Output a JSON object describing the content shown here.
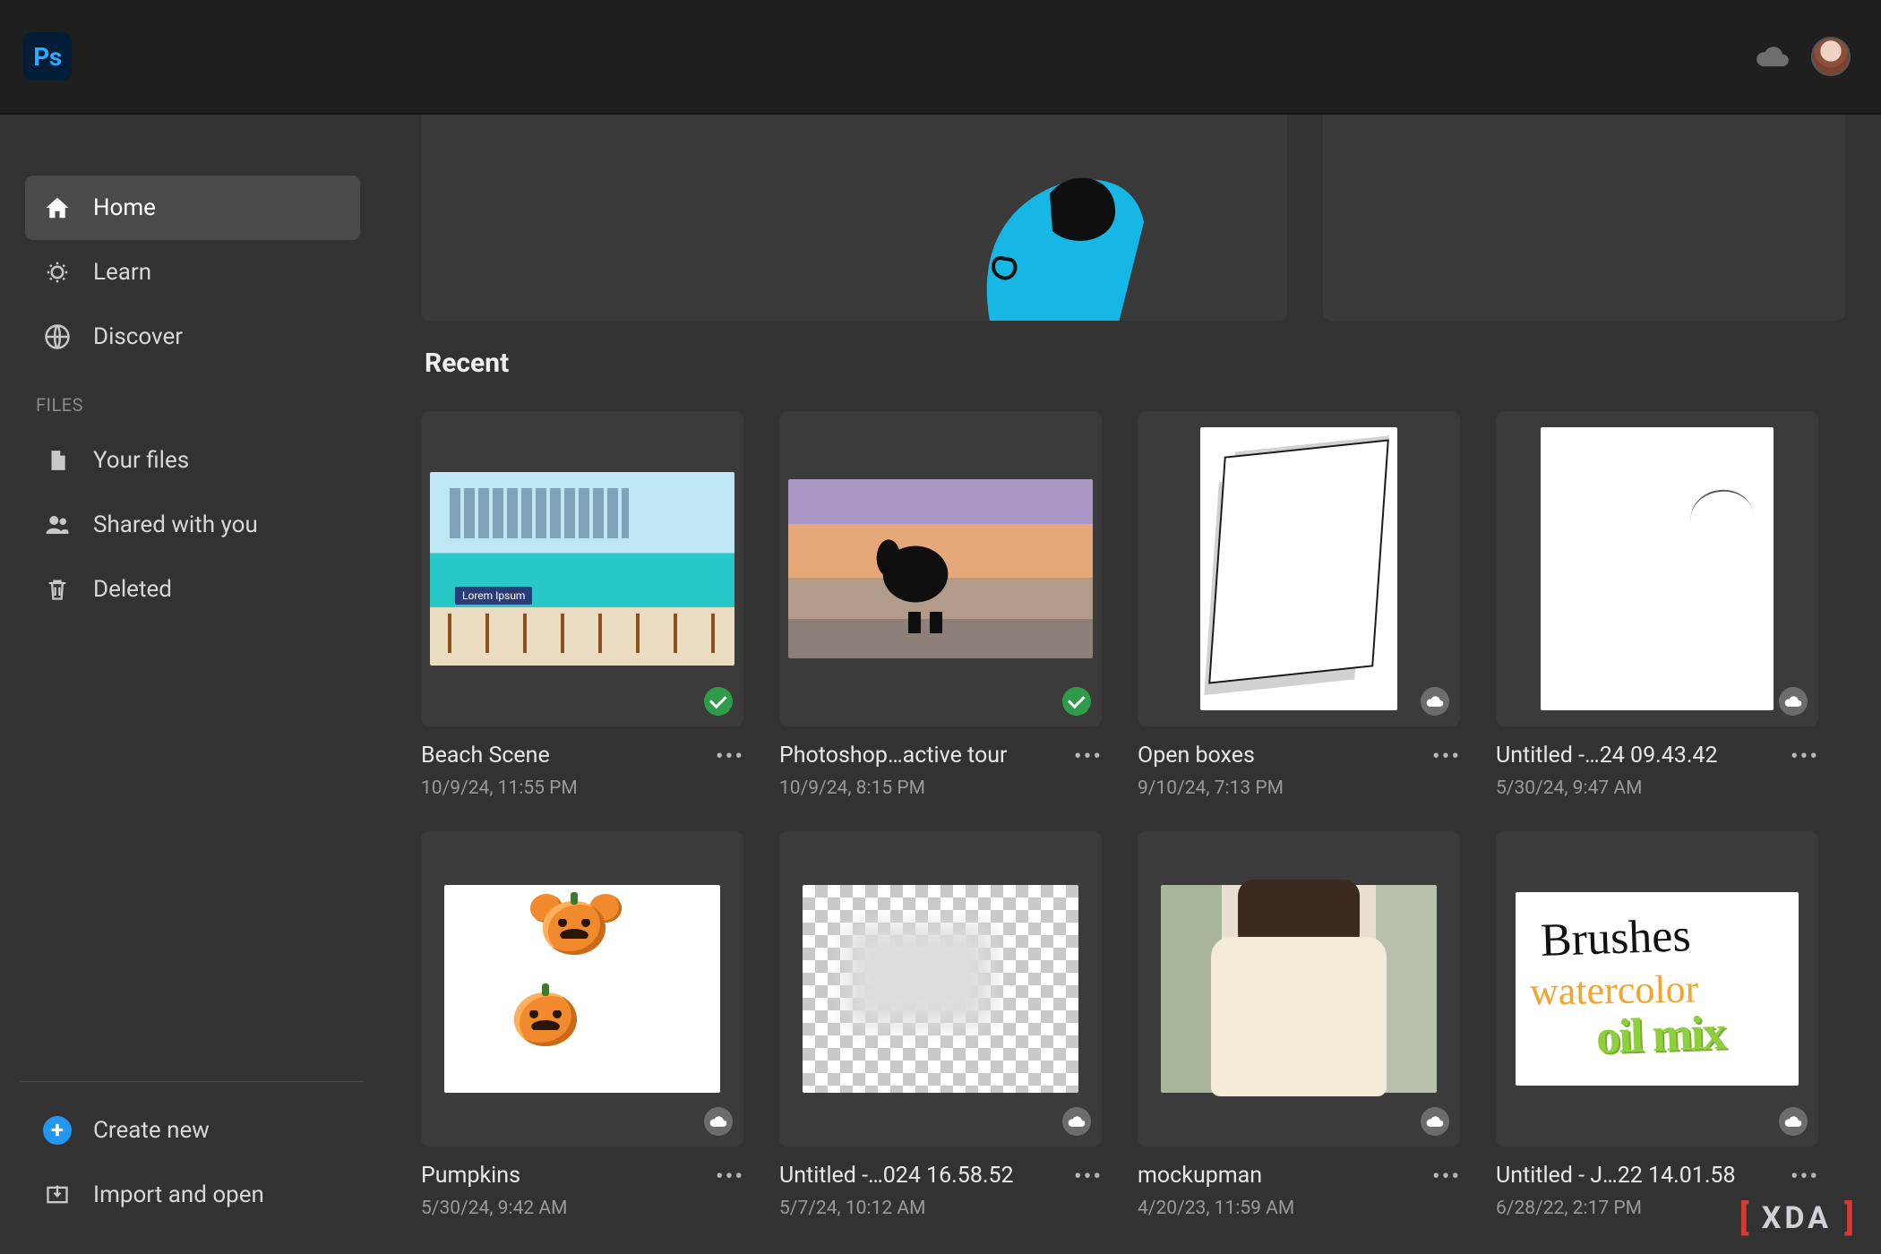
{
  "app": {
    "logo_text": "Ps"
  },
  "sidebar": {
    "items": [
      {
        "label": "Home",
        "icon": "home-icon",
        "active": true
      },
      {
        "label": "Learn",
        "icon": "learn-icon",
        "active": false
      },
      {
        "label": "Discover",
        "icon": "discover-icon",
        "active": false
      }
    ],
    "files_section_label": "FILES",
    "files_items": [
      {
        "label": "Your files",
        "icon": "file-icon"
      },
      {
        "label": "Shared with you",
        "icon": "people-icon"
      },
      {
        "label": "Deleted",
        "icon": "trash-icon"
      }
    ],
    "create_new_label": "Create new",
    "import_open_label": "Import and open"
  },
  "main": {
    "recent_label": "Recent",
    "cards": [
      {
        "title": "Beach Scene",
        "date": "10/9/24, 11:55 PM",
        "status": "synced"
      },
      {
        "title": "Photoshop…active tour",
        "date": "10/9/24, 8:15 PM",
        "status": "synced"
      },
      {
        "title": "Open boxes",
        "date": "9/10/24, 7:13 PM",
        "status": "cloud"
      },
      {
        "title": "Untitled -…24 09.43.42",
        "date": "5/30/24, 9:47 AM",
        "status": "cloud"
      },
      {
        "title": "Pumpkins",
        "date": "5/30/24, 9:42 AM",
        "status": "cloud"
      },
      {
        "title": "Untitled -…024 16.58.52",
        "date": "5/7/24, 10:12 AM",
        "status": "cloud"
      },
      {
        "title": "mockupman",
        "date": "4/20/23, 11:59 AM",
        "status": "cloud"
      },
      {
        "title": "Untitled - J…22 14.01.58",
        "date": "6/28/22, 2:17 PM",
        "status": "cloud"
      }
    ]
  },
  "watermark": {
    "text": "XDA"
  },
  "thumb_text": {
    "beach_lorem": "Lorem  Ipsum",
    "brushes_line1": "Brushes",
    "brushes_line2": "watercolor",
    "brushes_line3": "oil mix"
  }
}
